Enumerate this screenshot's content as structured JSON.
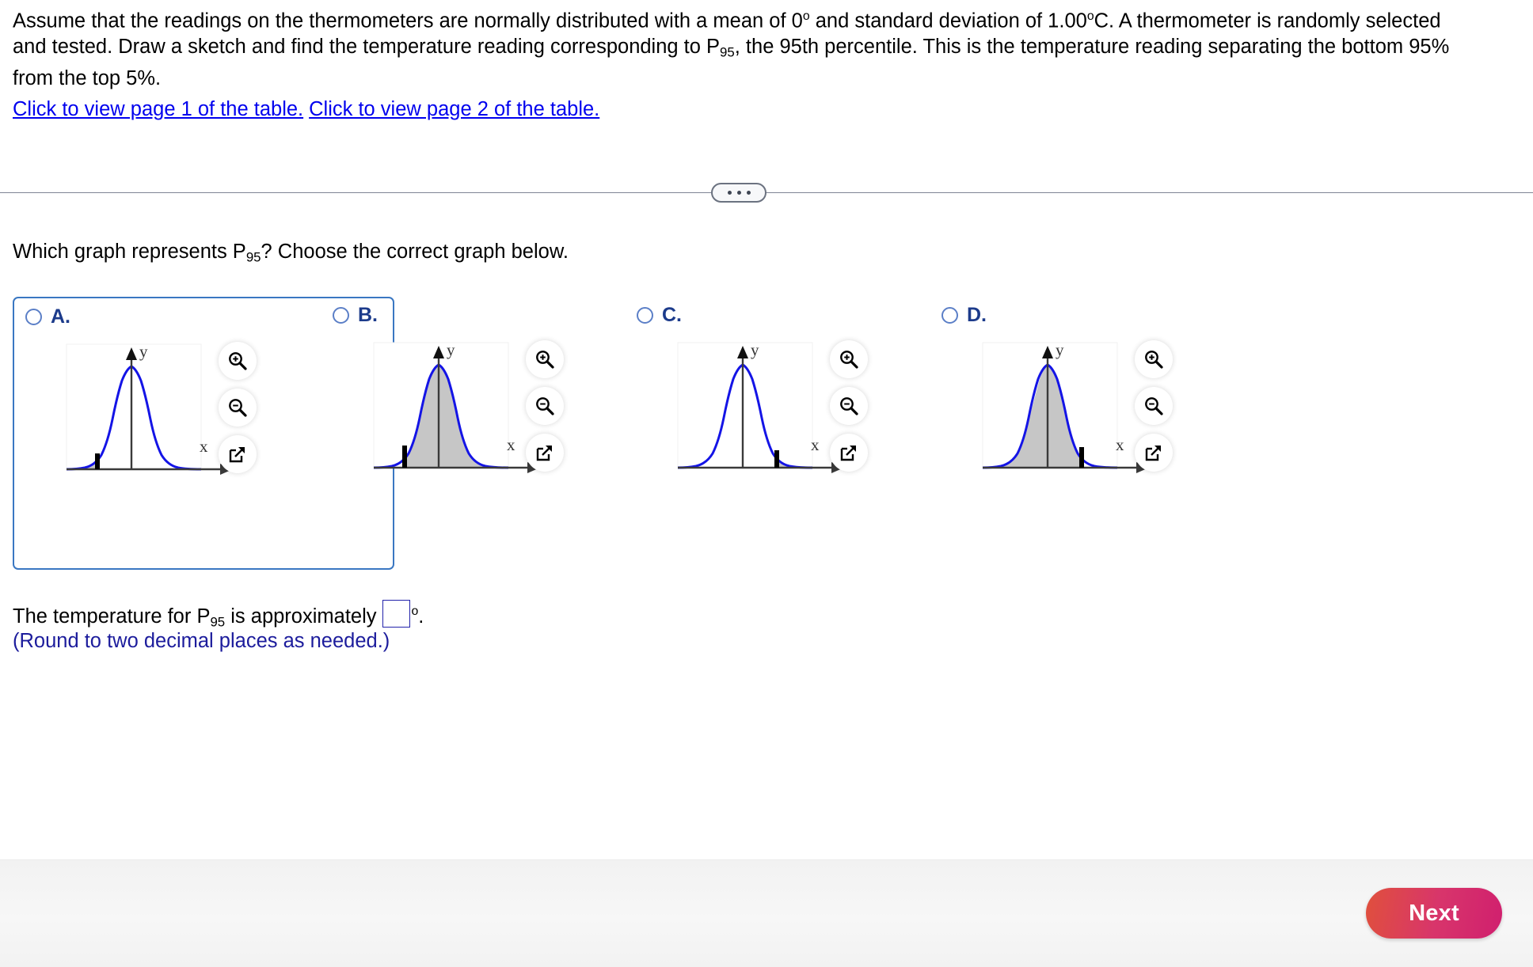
{
  "problem": {
    "line1": "Assume that the readings on the thermometers are normally distributed with a mean of 0",
    "line1b": " and standard deviation of 1.00",
    "line1c": "C. A thermometer is randomly selected",
    "line2a": "and tested. Draw a sketch and find the temperature reading corresponding to P",
    "line2b": "95",
    "line2c": ", the 95th percentile. This is the temperature reading separating the bottom 95%",
    "line3": "from the top 5%.",
    "degree_symbol": "o"
  },
  "links": {
    "page1": "Click to view page 1 of the table.",
    "page2": "Click to view page 2 of the table."
  },
  "divider": {
    "ellipsis": "..."
  },
  "prompt": {
    "part1": "Which graph represents P",
    "sub": "95",
    "part2": "? Choose the correct graph below."
  },
  "choices": [
    {
      "letter": "A.",
      "selected": true,
      "axis_x_label": "x",
      "axis_y_label": "y",
      "bar_position": -1.645,
      "shaded_region": "left-tail-only",
      "tools": [
        "zoom-in-icon",
        "zoom-out-icon",
        "pop-out-icon"
      ]
    },
    {
      "letter": "B.",
      "selected": false,
      "axis_x_label": "x",
      "axis_y_label": "y",
      "bar_position": -1.645,
      "shaded_region": "right-of-bar",
      "tools": [
        "zoom-in-icon",
        "zoom-out-icon",
        "pop-out-icon"
      ]
    },
    {
      "letter": "C.",
      "selected": false,
      "axis_x_label": "x",
      "axis_y_label": "y",
      "bar_position": 1.645,
      "shaded_region": "right-tail-only",
      "tools": [
        "zoom-in-icon",
        "zoom-out-icon",
        "pop-out-icon"
      ]
    },
    {
      "letter": "D.",
      "selected": false,
      "axis_x_label": "x",
      "axis_y_label": "y",
      "bar_position": 1.645,
      "shaded_region": "left-of-bar",
      "tools": [
        "zoom-in-icon",
        "zoom-out-icon",
        "pop-out-icon"
      ]
    }
  ],
  "answer": {
    "part1": "The temperature for P",
    "sub": "95",
    "part2": " is approximately",
    "input_value": "",
    "degree_symbol": "o",
    "period": ".",
    "note": "(Round to two decimal places as needed.)"
  },
  "footer": {
    "next_label": "Next"
  },
  "colors": {
    "curve": "#1414e6",
    "shading": "#c6c6c6",
    "link": "#0000ee",
    "selection_border": "#3a77c2",
    "letter": "#1c3b8b",
    "note": "#1c1c9c",
    "next_gradient_from": "#e0503c",
    "next_gradient_to": "#d01f6e"
  }
}
